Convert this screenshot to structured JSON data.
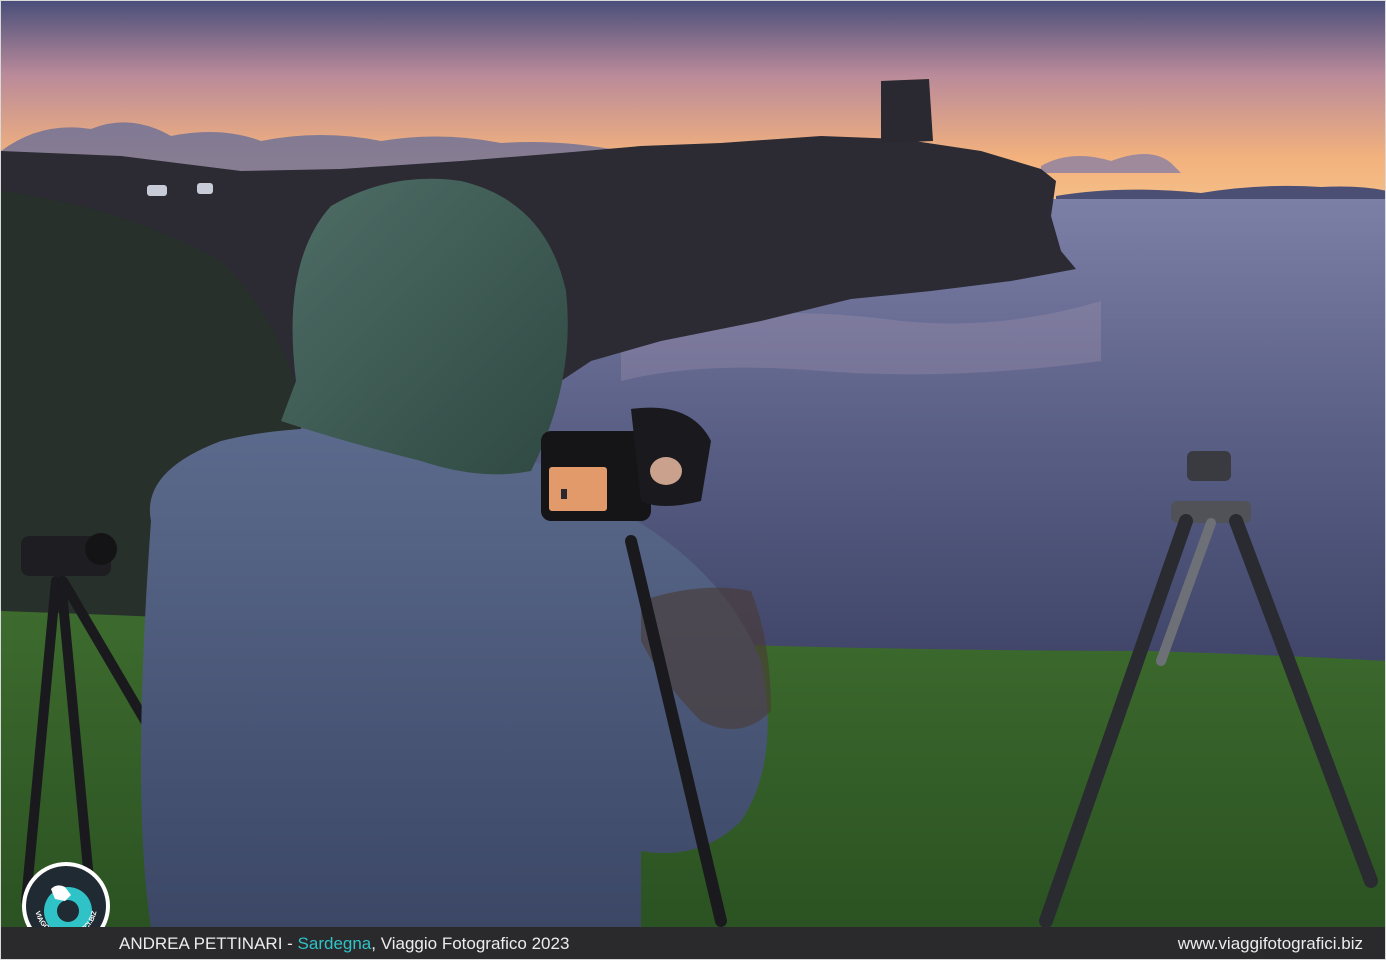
{
  "caption": {
    "author": "ANDREA PETTINARI",
    "separator": " - ",
    "location": "Sardegna",
    "trip": ", Viaggio Fotografico 2023",
    "website": "www.viaggifotografici.biz"
  },
  "logo": {
    "text": "VIAGGIFOTOGRAFICI.BIZ",
    "icon": "photographer-silhouette-icon"
  },
  "colors": {
    "accent": "#2fc3c8",
    "caption_bg": "#2a2a2c",
    "sky_top": "#4a4f7a",
    "sky_horizon": "#f6b57a"
  }
}
